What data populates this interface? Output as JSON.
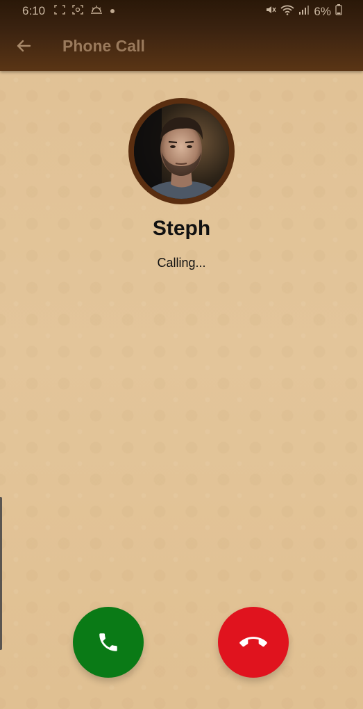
{
  "status_bar": {
    "time": "6:10",
    "battery": "6%",
    "icons": [
      "screenshot-icon",
      "focus-icon",
      "weather-icon",
      "dot-icon",
      "mute-icon",
      "wifi-icon",
      "signal-icon",
      "battery-icon"
    ]
  },
  "app_bar": {
    "title": "Phone Call",
    "back_icon": "arrow-left-icon"
  },
  "contact": {
    "name": "Steph",
    "call_status": "Calling..."
  },
  "actions": {
    "accept_icon": "phone-icon",
    "decline_icon": "phone-hangup-icon"
  },
  "colors": {
    "background": "#e2c398",
    "app_bar": "#3a2210",
    "title": "#9a7a5c",
    "accept": "#0a7a16",
    "decline": "#e0131e",
    "avatar_ring": "#5a2e10"
  }
}
